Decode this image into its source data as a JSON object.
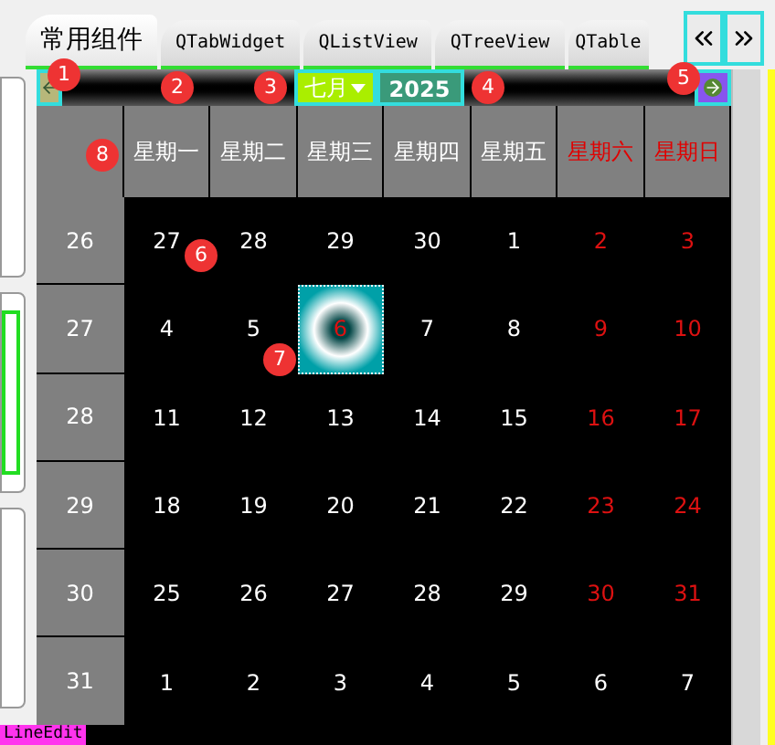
{
  "tabs": [
    {
      "label": "常用组件",
      "selected": true
    },
    {
      "label": "QTabWidget",
      "selected": false
    },
    {
      "label": "QListView",
      "selected": false
    },
    {
      "label": "QTreeView",
      "selected": false
    },
    {
      "label": "QTable",
      "selected": false
    }
  ],
  "calendar": {
    "month": "七月",
    "year": "2025",
    "weekdays": [
      {
        "label": "星期一",
        "weekend": false
      },
      {
        "label": "星期二",
        "weekend": false
      },
      {
        "label": "星期三",
        "weekend": false
      },
      {
        "label": "星期四",
        "weekend": false
      },
      {
        "label": "星期五",
        "weekend": false
      },
      {
        "label": "星期六",
        "weekend": true
      },
      {
        "label": "星期日",
        "weekend": true
      }
    ],
    "rows": [
      {
        "week": "26",
        "days": [
          {
            "day": "27",
            "red": false,
            "selected": false
          },
          {
            "day": "28",
            "red": false,
            "selected": false
          },
          {
            "day": "29",
            "red": false,
            "selected": false
          },
          {
            "day": "30",
            "red": false,
            "selected": false
          },
          {
            "day": "1",
            "red": false,
            "selected": false
          },
          {
            "day": "2",
            "red": true,
            "selected": false
          },
          {
            "day": "3",
            "red": true,
            "selected": false
          }
        ]
      },
      {
        "week": "27",
        "days": [
          {
            "day": "4",
            "red": false,
            "selected": false
          },
          {
            "day": "5",
            "red": false,
            "selected": false
          },
          {
            "day": "6",
            "red": true,
            "selected": true
          },
          {
            "day": "7",
            "red": false,
            "selected": false
          },
          {
            "day": "8",
            "red": false,
            "selected": false
          },
          {
            "day": "9",
            "red": true,
            "selected": false
          },
          {
            "day": "10",
            "red": true,
            "selected": false
          }
        ]
      },
      {
        "week": "28",
        "days": [
          {
            "day": "11",
            "red": false,
            "selected": false
          },
          {
            "day": "12",
            "red": false,
            "selected": false
          },
          {
            "day": "13",
            "red": false,
            "selected": false
          },
          {
            "day": "14",
            "red": false,
            "selected": false
          },
          {
            "day": "15",
            "red": false,
            "selected": false
          },
          {
            "day": "16",
            "red": true,
            "selected": false
          },
          {
            "day": "17",
            "red": true,
            "selected": false
          }
        ]
      },
      {
        "week": "29",
        "days": [
          {
            "day": "18",
            "red": false,
            "selected": false
          },
          {
            "day": "19",
            "red": false,
            "selected": false
          },
          {
            "day": "20",
            "red": false,
            "selected": false
          },
          {
            "day": "21",
            "red": false,
            "selected": false
          },
          {
            "day": "22",
            "red": false,
            "selected": false
          },
          {
            "day": "23",
            "red": true,
            "selected": false
          },
          {
            "day": "24",
            "red": true,
            "selected": false
          }
        ]
      },
      {
        "week": "30",
        "days": [
          {
            "day": "25",
            "red": false,
            "selected": false
          },
          {
            "day": "26",
            "red": false,
            "selected": false
          },
          {
            "day": "27",
            "red": false,
            "selected": false
          },
          {
            "day": "28",
            "red": false,
            "selected": false
          },
          {
            "day": "29",
            "red": false,
            "selected": false
          },
          {
            "day": "30",
            "red": true,
            "selected": false
          },
          {
            "day": "31",
            "red": true,
            "selected": false
          }
        ]
      },
      {
        "week": "31",
        "days": [
          {
            "day": "1",
            "red": false,
            "selected": false
          },
          {
            "day": "2",
            "red": false,
            "selected": false
          },
          {
            "day": "3",
            "red": false,
            "selected": false
          },
          {
            "day": "4",
            "red": false,
            "selected": false
          },
          {
            "day": "5",
            "red": false,
            "selected": false
          },
          {
            "day": "6",
            "red": false,
            "selected": false
          },
          {
            "day": "7",
            "red": false,
            "selected": false
          }
        ]
      }
    ]
  },
  "annotations": [
    "1",
    "2",
    "3",
    "4",
    "5",
    "6",
    "7",
    "8"
  ],
  "bottom_label": "LineEdit"
}
